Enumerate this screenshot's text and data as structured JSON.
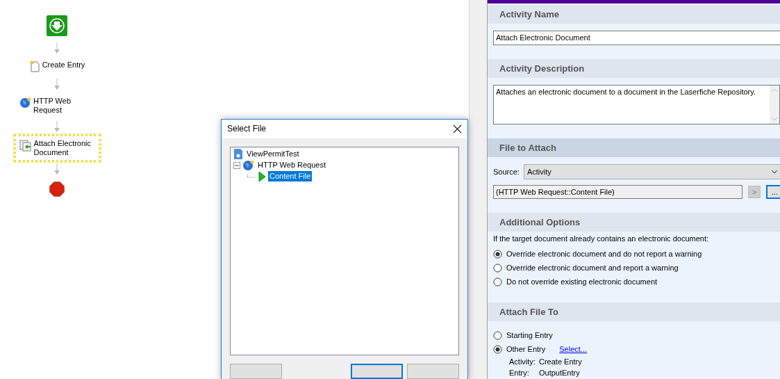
{
  "workflow": {
    "nodes": [
      {
        "kind": "start",
        "selected": false
      },
      {
        "kind": "create",
        "label": "Create Entry",
        "selected": false
      },
      {
        "kind": "web-request",
        "label": "HTTP Web Request",
        "selected": false
      },
      {
        "kind": "attach",
        "label": "Attach Electronic Document",
        "selected": true
      },
      {
        "kind": "end",
        "selected": false
      }
    ]
  },
  "dialog": {
    "title": "Select File",
    "tree": [
      {
        "kind": "workflow",
        "label": "ViewPermitTest",
        "selected": false,
        "children": [
          {
            "kind": "web-request",
            "label": "HTTP Web Request",
            "expanded": true,
            "selected": false,
            "children": [
              {
                "kind": "file",
                "label": "Content File",
                "selected": true
              }
            ]
          }
        ]
      }
    ]
  },
  "properties": {
    "sections": [
      {
        "kind": "name",
        "heading": "Activity Name",
        "active": false,
        "value": "Attach Electronic Document"
      },
      {
        "kind": "description",
        "heading": "Activity Description",
        "active": false,
        "value": "Attaches an electronic document to a document in the Laserfiche Repository."
      },
      {
        "kind": "file",
        "heading": "File to Attach",
        "active": true,
        "source_label": "Source:",
        "source_value": "Activity",
        "file_value": "(HTTP Web Request::Content File)",
        "insert_button": ">",
        "browse_button": "..."
      },
      {
        "kind": "options",
        "heading": "Additional Options",
        "active": false,
        "prompt": "If the target document already contains an electronic document:",
        "options": [
          {
            "label": "Override electronic document and do not report a warning",
            "selected": true
          },
          {
            "label": "Override electronic document and report a warning",
            "selected": false
          },
          {
            "label": "Do not override existing electronic document",
            "selected": false
          }
        ]
      },
      {
        "kind": "target",
        "heading": "Attach File To",
        "active": false,
        "options": [
          {
            "label": "Starting Entry",
            "selected": false
          },
          {
            "label": "Other Entry",
            "selected": true,
            "link": "Select..."
          }
        ],
        "details": [
          {
            "label": "Activity:",
            "value": "Create Entry"
          },
          {
            "label": "Entry:",
            "value": "OutputEntry"
          }
        ]
      }
    ]
  }
}
